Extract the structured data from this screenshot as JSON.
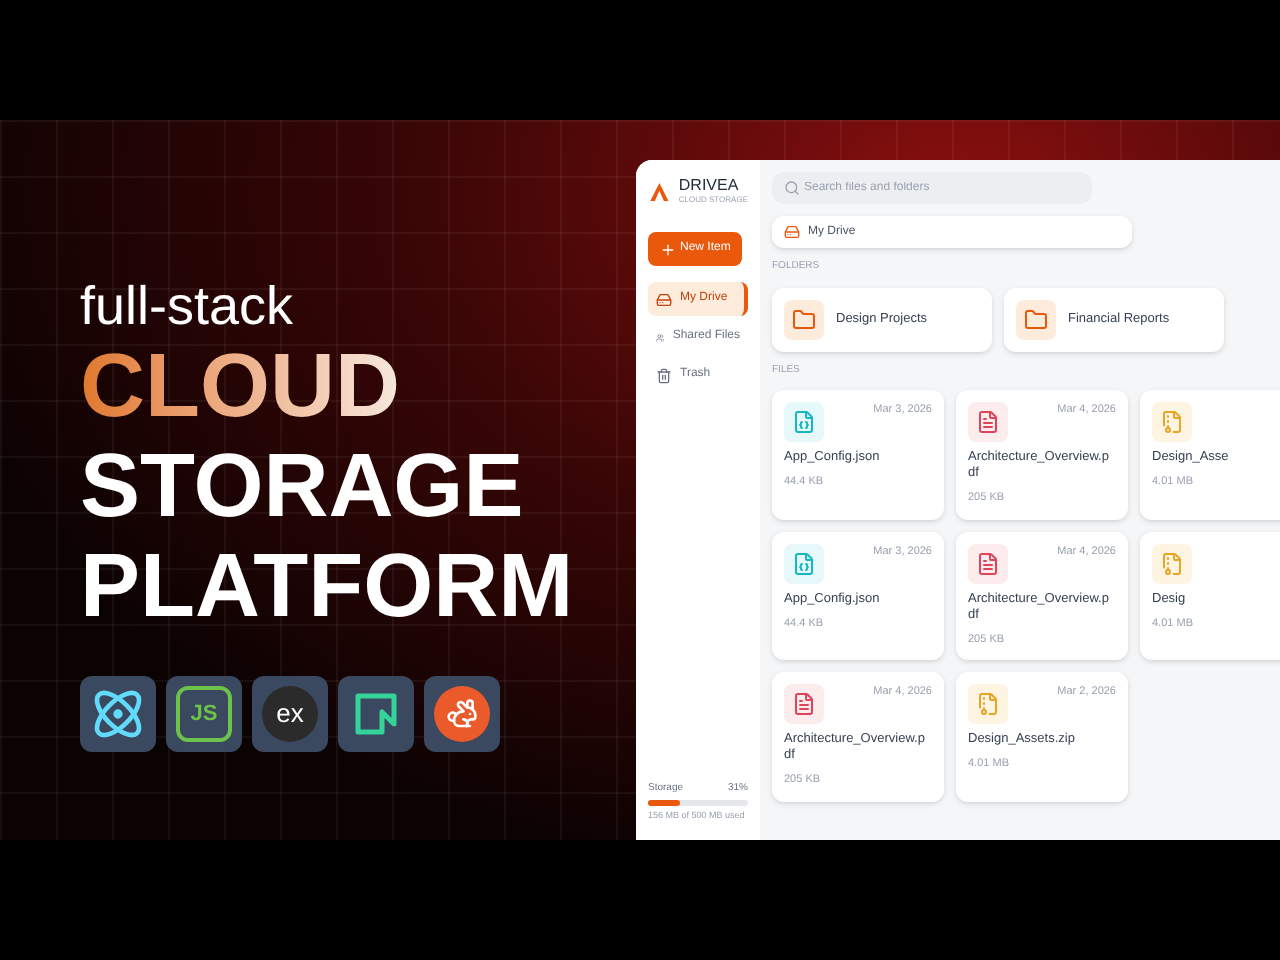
{
  "headline": {
    "kicker": "full-stack",
    "lines": [
      {
        "text": "CLOUD",
        "accent": true
      },
      {
        "text": "STORAGE",
        "accent": false
      },
      {
        "text": "PLATFORM",
        "accent": false
      }
    ]
  },
  "tech_logos": [
    {
      "kind": "react"
    },
    {
      "kind": "node",
      "label": "JS"
    },
    {
      "kind": "express",
      "label": "ex"
    },
    {
      "kind": "neon"
    },
    {
      "kind": "rabbit"
    }
  ],
  "app": {
    "brand": {
      "name": "DRIVEA",
      "tagline": "CLOUD STORAGE"
    },
    "new_button": "New Item",
    "nav": [
      {
        "label": "My Drive",
        "selected": true
      },
      {
        "label": "Shared Files",
        "selected": false
      },
      {
        "label": "Trash",
        "selected": false
      }
    ],
    "storage": {
      "label": "Storage",
      "percent": "31%",
      "level": 0.31,
      "note": "156 MB of 500 MB used"
    },
    "search": {
      "placeholder": "Search files and folders"
    },
    "breadcrumb": "My Drive",
    "folders": {
      "heading": "FOLDERS",
      "items": [
        "Design Projects",
        "Financial Reports"
      ]
    },
    "files": {
      "heading": "FILES",
      "items": [
        {
          "kind": "json",
          "name": "App_Config.json",
          "size": "44.4 KB",
          "date": "Mar 3, 2026"
        },
        {
          "kind": "pdf",
          "name": "Architecture_Overview.pdf",
          "size": "205 KB",
          "date": "Mar 4, 2026"
        },
        {
          "kind": "zip",
          "name": "Design_Asse",
          "size": "4.01 MB"
        },
        {
          "kind": "json",
          "name": "App_Config.json",
          "size": "44.4 KB",
          "date": "Mar 3, 2026"
        },
        {
          "kind": "pdf",
          "name": "Architecture_Overview.pdf",
          "size": "205 KB",
          "date": "Mar 4, 2026"
        },
        {
          "kind": "zip",
          "name": "Desig",
          "size": "4.01 MB"
        },
        {
          "kind": "pdf",
          "name": "Architecture_Overview.pdf",
          "size": "205 KB",
          "date": "Mar 4, 2026"
        },
        {
          "kind": "zip",
          "name": "Design_Assets.zip",
          "size": "4.01 MB",
          "date": "Mar 2, 2026"
        }
      ]
    }
  }
}
